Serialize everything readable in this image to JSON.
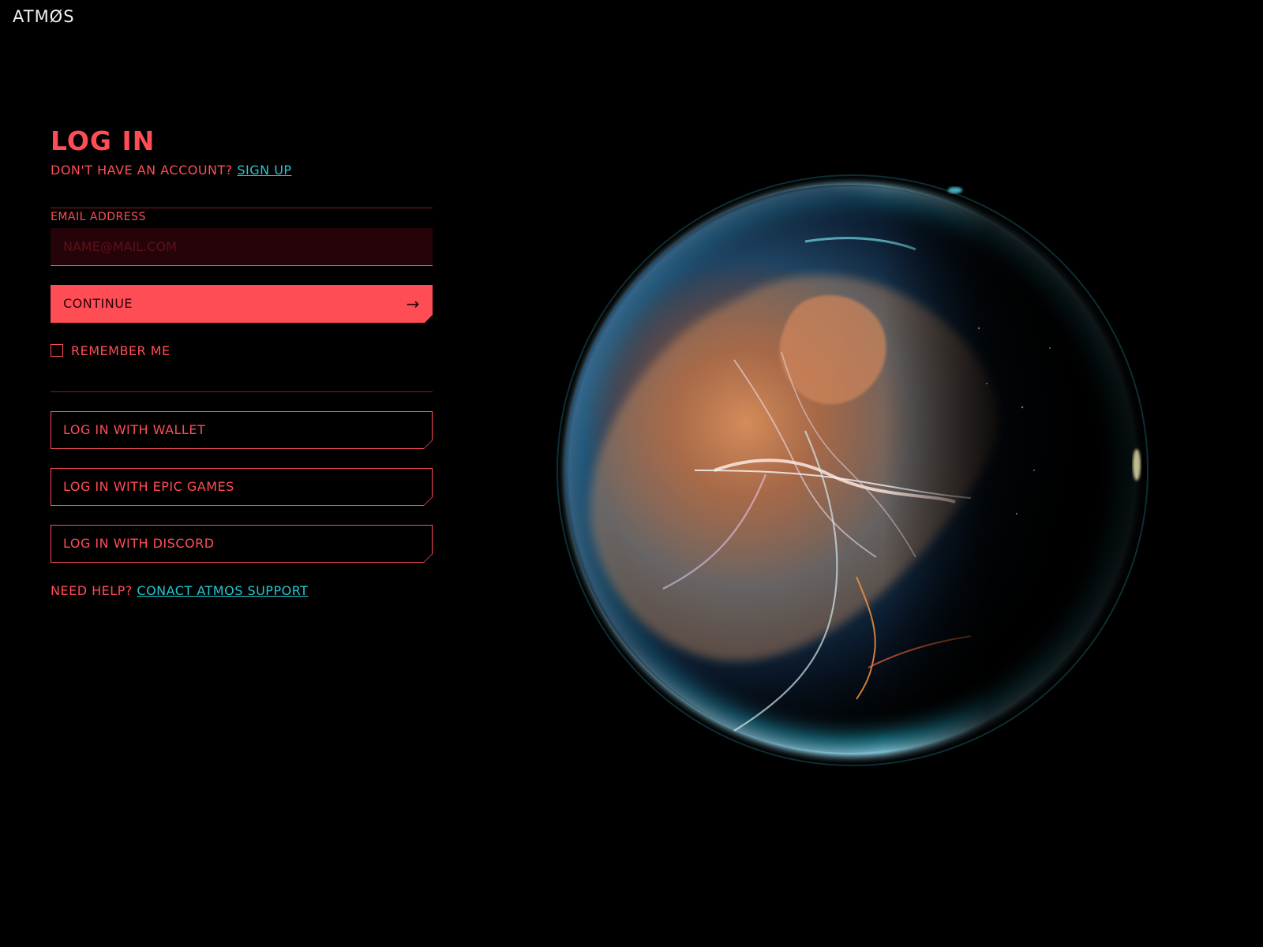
{
  "app": {
    "logo_text": "ATMØS"
  },
  "login": {
    "title": "LOG IN",
    "no_account_text": "DON'T HAVE AN ACCOUNT?",
    "signup_link": "SIGN UP",
    "email_label": "EMAIL ADDRESS",
    "email_placeholder": "NAME@MAIL.COM",
    "email_value": "",
    "continue_label": "CONTINUE",
    "continue_icon": "arrow-right-icon",
    "remember_label": "REMEMBER ME",
    "remember_checked": false
  },
  "social_logins": [
    {
      "label": "LOG IN WITH WALLET"
    },
    {
      "label": "LOG IN WITH EPIC  GAMES"
    },
    {
      "label": "LOG IN WITH DISCORD"
    }
  ],
  "help": {
    "text": "NEED HELP?",
    "link": "CONACT ATMOS SUPPORT"
  },
  "colors": {
    "background": "#000000",
    "accent": "#ff4d56",
    "link": "#26c7cf",
    "input_bg": "#240408"
  }
}
